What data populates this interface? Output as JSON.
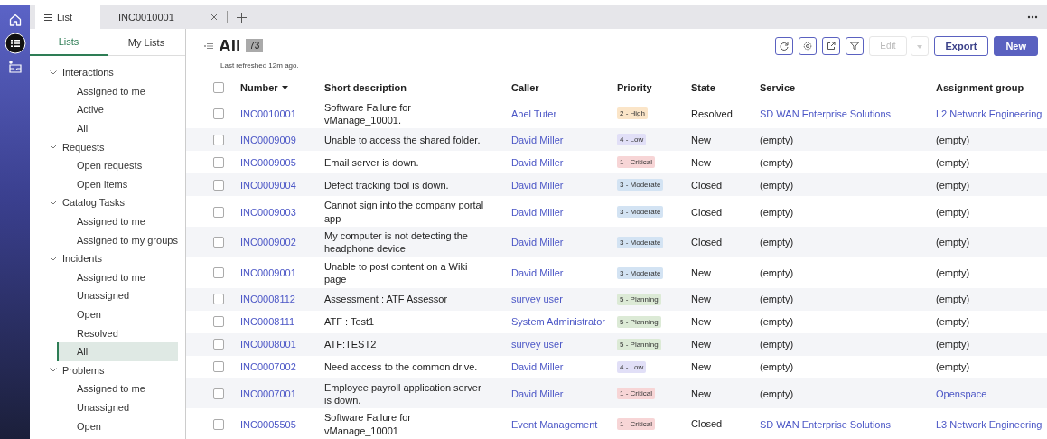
{
  "tabs": [
    {
      "label": "List",
      "selected": true,
      "closable": false
    },
    {
      "label": "INC0010001",
      "selected": false,
      "closable": true
    }
  ],
  "sidebar": {
    "tabs": [
      {
        "label": "Lists",
        "selected": true
      },
      {
        "label": "My Lists",
        "selected": false
      }
    ],
    "groups": [
      {
        "label": "Interactions",
        "expanded": true,
        "children": [
          {
            "label": "Assigned to me",
            "selected": false
          },
          {
            "label": "Active",
            "selected": false
          },
          {
            "label": "All",
            "selected": false
          }
        ]
      },
      {
        "label": "Requests",
        "expanded": true,
        "children": [
          {
            "label": "Open requests",
            "selected": false
          },
          {
            "label": "Open items",
            "selected": false
          }
        ]
      },
      {
        "label": "Catalog Tasks",
        "expanded": true,
        "children": [
          {
            "label": "Assigned to me",
            "selected": false
          },
          {
            "label": "Assigned to my groups",
            "selected": false
          }
        ]
      },
      {
        "label": "Incidents",
        "expanded": true,
        "children": [
          {
            "label": "Assigned to me",
            "selected": false
          },
          {
            "label": "Unassigned",
            "selected": false
          },
          {
            "label": "Open",
            "selected": false
          },
          {
            "label": "Resolved",
            "selected": false
          },
          {
            "label": "All",
            "selected": true
          }
        ]
      },
      {
        "label": "Problems",
        "expanded": true,
        "children": [
          {
            "label": "Assigned to me",
            "selected": false
          },
          {
            "label": "Unassigned",
            "selected": false
          },
          {
            "label": "Open",
            "selected": false
          }
        ]
      }
    ]
  },
  "list": {
    "title": "All",
    "count": "73",
    "refreshed": "Last refreshed 12m ago.",
    "toolbar": [
      {
        "kind": "refresh",
        "disabled": false
      },
      {
        "kind": "settings",
        "disabled": false
      },
      {
        "kind": "share",
        "disabled": false
      },
      {
        "kind": "filter",
        "disabled": false
      },
      {
        "kind": "split",
        "label": "Edit",
        "disabled": true
      },
      {
        "kind": "secondary",
        "label": "Export",
        "disabled": false
      },
      {
        "kind": "primary",
        "label": "New",
        "disabled": false
      }
    ],
    "select_all_checked": false,
    "columns": [
      {
        "label": "Number",
        "sorted": true
      },
      {
        "label": "Short description",
        "sorted": false
      },
      {
        "label": "Caller",
        "sorted": false
      },
      {
        "label": "Priority",
        "sorted": false
      },
      {
        "label": "State",
        "sorted": false
      },
      {
        "label": "Service",
        "sorted": false
      },
      {
        "label": "Assignment group",
        "sorted": false
      }
    ],
    "rows": [
      {
        "checked": false,
        "number": "INC0010001",
        "description": "Software Failure for vManage_10001.",
        "caller": "Abel Tuter",
        "priority": {
          "label": "2 - High",
          "color": "#fbe5c8"
        },
        "state": "Resolved",
        "service": {
          "text": "SD WAN Enterprise Solutions",
          "link": true
        },
        "group": {
          "text": "L2 Network Engineering",
          "link": true
        }
      },
      {
        "checked": false,
        "number": "INC0009009",
        "description": "Unable to access the shared folder.",
        "caller": "David Miller",
        "priority": {
          "label": "4 - Low",
          "color": "#e1dff7"
        },
        "state": "New",
        "service": {
          "text": "(empty)",
          "link": false
        },
        "group": {
          "text": "(empty)",
          "link": false
        }
      },
      {
        "checked": false,
        "number": "INC0009005",
        "description": "Email server is down.",
        "caller": "David Miller",
        "priority": {
          "label": "1 - Critical",
          "color": "#f7d5d6"
        },
        "state": "New",
        "service": {
          "text": "(empty)",
          "link": false
        },
        "group": {
          "text": "(empty)",
          "link": false
        }
      },
      {
        "checked": false,
        "number": "INC0009004",
        "description": "Defect tracking tool is down.",
        "caller": "David Miller",
        "priority": {
          "label": "3 - Moderate",
          "color": "#d3e3f3"
        },
        "state": "Closed",
        "service": {
          "text": "(empty)",
          "link": false
        },
        "group": {
          "text": "(empty)",
          "link": false
        }
      },
      {
        "checked": false,
        "number": "INC0009003",
        "description": "Cannot sign into the company portal app",
        "caller": "David Miller",
        "priority": {
          "label": "3 - Moderate",
          "color": "#d3e3f3"
        },
        "state": "Closed",
        "service": {
          "text": "(empty)",
          "link": false
        },
        "group": {
          "text": "(empty)",
          "link": false
        }
      },
      {
        "checked": false,
        "number": "INC0009002",
        "description": "My computer is not detecting the headphone device",
        "caller": "David Miller",
        "priority": {
          "label": "3 - Moderate",
          "color": "#d3e3f3"
        },
        "state": "Closed",
        "service": {
          "text": "(empty)",
          "link": false
        },
        "group": {
          "text": "(empty)",
          "link": false
        }
      },
      {
        "checked": false,
        "number": "INC0009001",
        "description": "Unable to post content on a Wiki page",
        "caller": "David Miller",
        "priority": {
          "label": "3 - Moderate",
          "color": "#d3e3f3"
        },
        "state": "New",
        "service": {
          "text": "(empty)",
          "link": false
        },
        "group": {
          "text": "(empty)",
          "link": false
        }
      },
      {
        "checked": false,
        "number": "INC0008112",
        "description": "Assessment : ATF Assessor",
        "caller": "survey user",
        "priority": {
          "label": "5 - Planning",
          "color": "#dcead6"
        },
        "state": "New",
        "service": {
          "text": "(empty)",
          "link": false
        },
        "group": {
          "text": "(empty)",
          "link": false
        }
      },
      {
        "checked": false,
        "number": "INC0008111",
        "description": "ATF : Test1",
        "caller": "System Administrator",
        "priority": {
          "label": "5 - Planning",
          "color": "#dcead6"
        },
        "state": "New",
        "service": {
          "text": "(empty)",
          "link": false
        },
        "group": {
          "text": "(empty)",
          "link": false
        }
      },
      {
        "checked": false,
        "number": "INC0008001",
        "description": "ATF:TEST2",
        "caller": "survey user",
        "priority": {
          "label": "5 - Planning",
          "color": "#dcead6"
        },
        "state": "New",
        "service": {
          "text": "(empty)",
          "link": false
        },
        "group": {
          "text": "(empty)",
          "link": false
        }
      },
      {
        "checked": false,
        "number": "INC0007002",
        "description": "Need access to the common drive.",
        "caller": "David Miller",
        "priority": {
          "label": "4 - Low",
          "color": "#e1dff7"
        },
        "state": "New",
        "service": {
          "text": "(empty)",
          "link": false
        },
        "group": {
          "text": "(empty)",
          "link": false
        }
      },
      {
        "checked": false,
        "number": "INC0007001",
        "description": "Employee payroll application server is down.",
        "caller": "David Miller",
        "priority": {
          "label": "1 - Critical",
          "color": "#f7d5d6"
        },
        "state": "New",
        "service": {
          "text": "(empty)",
          "link": false
        },
        "group": {
          "text": "Openspace",
          "link": true
        }
      },
      {
        "checked": false,
        "number": "INC0005505",
        "description": "Software Failure for vManage_10001",
        "caller": "Event Management",
        "priority": {
          "label": "1 - Critical",
          "color": "#f7d5d6"
        },
        "state": "Closed",
        "service": {
          "text": "SD WAN Enterprise Solutions",
          "link": true
        },
        "group": {
          "text": "L3 Network Engineering",
          "link": true
        }
      }
    ]
  }
}
